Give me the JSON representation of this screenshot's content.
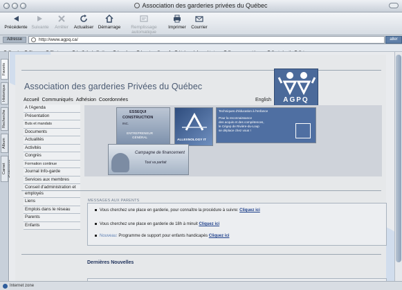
{
  "window": {
    "title": "Association des garderies privées du Québec"
  },
  "toolbar": {
    "buttons": [
      {
        "label": "Précédente",
        "icon": "back-arrow-icon",
        "enabled": true
      },
      {
        "label": "Suivante",
        "icon": "forward-arrow-icon",
        "enabled": false
      },
      {
        "label": "Arrêter",
        "icon": "stop-icon",
        "enabled": false
      },
      {
        "label": "Actualiser",
        "icon": "refresh-icon",
        "enabled": true
      },
      {
        "label": "Démarrage",
        "icon": "home-icon",
        "enabled": true
      },
      {
        "label": "Remplissage automatique",
        "icon": "autofill-icon",
        "enabled": false
      },
      {
        "label": "Imprimer",
        "icon": "print-icon",
        "enabled": true
      },
      {
        "label": "Courrier",
        "icon": "mail-icon",
        "enabled": true
      }
    ]
  },
  "address": {
    "label": "Adresse",
    "url": "http://www.agpq.ca/",
    "go_label": "aller"
  },
  "favorites": [
    "Google",
    "Cinema",
    "Photo.com",
    "La Toile du Québec",
    "logo free",
    "Logotype Free : A",
    "Linkers, Infographie inc.",
    "Gouvernement logos",
    "Squirelmail",
    "Sytem"
  ],
  "explorer_tabs": [
    "Favoris",
    "Historique",
    "Recherche",
    "Album",
    "Carnet d'adresses"
  ],
  "status": {
    "text": "Internet zone"
  },
  "page": {
    "site_title": "Association des garderies Privées du Québec",
    "nav_top": [
      "Accueil",
      "Communiqués",
      "Adhésion",
      "Coordonnées"
    ],
    "english_link": "English",
    "logo_text": "AGPQ",
    "left_nav": [
      {
        "label": "A l'Agenda",
        "small": false
      },
      {
        "label": "Présentation",
        "small": false
      },
      {
        "label": "Buts et mandats",
        "small": true
      },
      {
        "label": "Documents",
        "small": false
      },
      {
        "label": "Actualités",
        "small": false
      },
      {
        "label": "Activités",
        "small": false
      },
      {
        "label": "Congrès",
        "small": false
      },
      {
        "label": "Formation continue",
        "small": true
      },
      {
        "label": "Journal Info-garde",
        "small": false
      },
      {
        "label": "Services aux membres",
        "small": false
      },
      {
        "label": "Conseil d'administration et employés",
        "small": false
      },
      {
        "label": "Liens",
        "small": false
      },
      {
        "label": "Emplois dans le réseau",
        "small": false
      },
      {
        "label": "Parents",
        "small": false
      },
      {
        "label": "Enfants",
        "small": false
      }
    ],
    "ads": {
      "essequi": [
        "ESSEQUI",
        "CONSTRUCTION",
        "INC.",
        "ENTREPRENEUR",
        "GÉNÉRAL"
      ],
      "allexnology": "ALLEXNOLOGY IT",
      "tech": [
        "Techniques d'éducation à l'enfance",
        "Pour la reconnaissance",
        "des acquis et des compétences,",
        "le Cégep de Rivière-du-Loup",
        "se déplace chez vous !"
      ],
      "campagne": [
        "Campagne de financement",
        "Tout va parfait"
      ]
    },
    "messages_title": "MESSAGES AUX PARENTS",
    "messages": [
      {
        "text": "Vous cherchez une place en garderie, pour connaître la procédure à suivre:",
        "link": "Cliquez ici",
        "prefix": ""
      },
      {
        "text": "Vous cherchez une place en garderie de 18h à minuit",
        "link": "Cliquez ici",
        "prefix": ""
      },
      {
        "text": "Programme de support pour enfants handicapés",
        "link": "Cliquez ici",
        "prefix": "Nouveau:"
      }
    ],
    "news_title": "Dernières Nouvelles"
  }
}
